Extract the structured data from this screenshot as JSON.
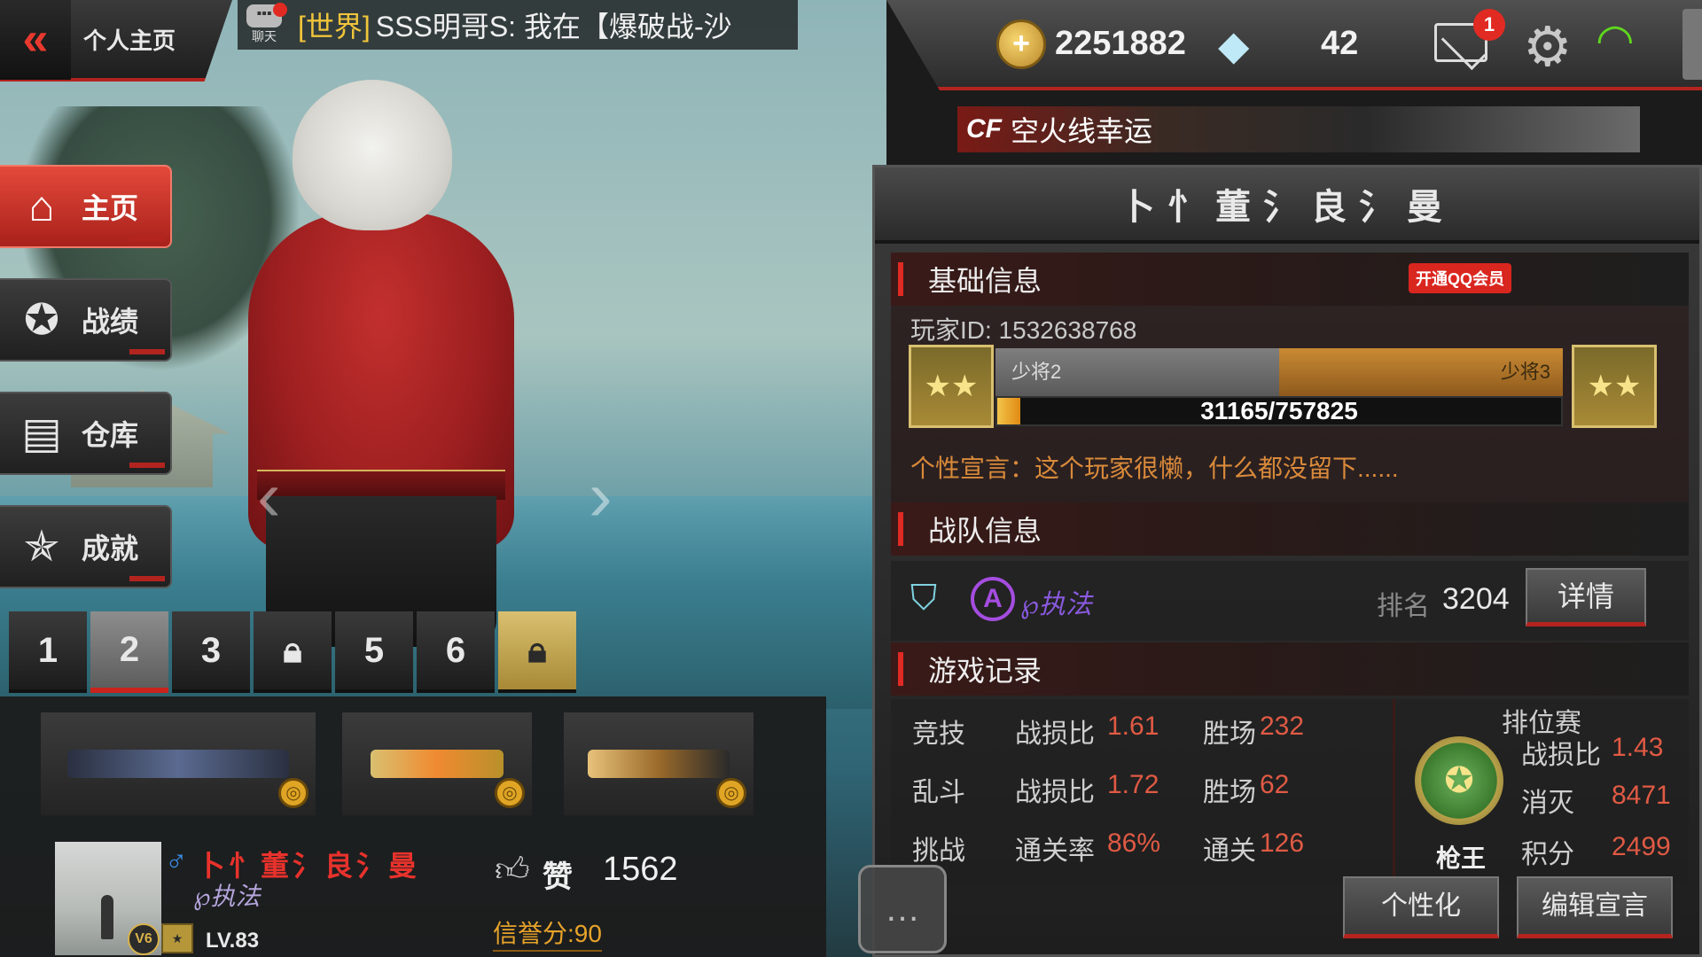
{
  "header": {
    "back_icon": "double-chevron-left-icon",
    "title": "个人主页"
  },
  "chat": {
    "icon_label": "聊天",
    "channel": "[世界]",
    "message": "SSS明哥S: 我在【爆破战-沙"
  },
  "side_nav": [
    {
      "label": "主页",
      "icon": "house-icon",
      "active": true
    },
    {
      "label": "战绩",
      "icon": "star-wings-icon",
      "active": false
    },
    {
      "label": "仓库",
      "icon": "crate-icon",
      "active": false
    },
    {
      "label": "成就",
      "icon": "trophy-star-icon",
      "active": false
    }
  ],
  "slots": [
    {
      "label": "1",
      "locked": false
    },
    {
      "label": "2",
      "locked": false,
      "active": true
    },
    {
      "label": "3",
      "locked": false
    },
    {
      "label": "",
      "locked": true
    },
    {
      "label": "5",
      "locked": false
    },
    {
      "label": "6",
      "locked": false
    },
    {
      "label": "",
      "locked": true,
      "gold": true
    }
  ],
  "weapons": [
    {
      "name": "primary-rifle",
      "icon": "rifle-icon"
    },
    {
      "name": "secondary-pistol",
      "icon": "pistol-icon"
    },
    {
      "name": "melee-weapon",
      "icon": "blade-icon"
    }
  ],
  "player": {
    "gender_symbol": "♂",
    "name": "卜忄董氵良氵曼",
    "tag": "℘执法",
    "vip": "V6",
    "level": "LV.83",
    "like_label": "赞",
    "likes": "1562",
    "credit": "信誉分:90"
  },
  "currency": {
    "gold": "2251882",
    "diamonds": "42",
    "mail_badge": "1"
  },
  "banner": {
    "logo": "CF",
    "text": "空火线幸运"
  },
  "panel": {
    "title": "卜忄董氵良氵曼",
    "basic_info_header": "基础信息",
    "qq_member_label": "开通QQ会员",
    "player_id": "玩家ID: 1532638768",
    "rank_current": "少将2",
    "rank_next": "少将3",
    "xp_text": "31165/757825",
    "xp_progress": 0.041,
    "motto": "个性宣言：这个玩家很懒，什么都没留下......",
    "team_header": "战队信息",
    "team_name": "℘执法",
    "team_rank_label": "排名",
    "team_rank": "3204",
    "team_detail_button": "详情",
    "records_header": "游戏记录",
    "records": [
      {
        "mode": "竞技",
        "k1": "战损比",
        "v1": "1.61",
        "k2": "胜场",
        "v2": "232"
      },
      {
        "mode": "乱斗",
        "k1": "战损比",
        "v1": "1.72",
        "k2": "胜场",
        "v2": "62"
      },
      {
        "mode": "挑战",
        "k1": "通关率",
        "v1": "86%",
        "k2": "通关",
        "v2": "126"
      }
    ],
    "ranked": {
      "title": "排位赛",
      "emblem_label": "枪王",
      "rows": [
        {
          "k": "战损比",
          "v": "1.43"
        },
        {
          "k": "消灭",
          "v": "8471"
        },
        {
          "k": "积分",
          "v": "2499"
        }
      ]
    },
    "button_personalize": "个性化",
    "button_edit_motto": "编辑宣言"
  },
  "colors": {
    "accent_red": "#e02a24",
    "stat_red": "#e05a44",
    "gold": "#e8a32a",
    "wifi_green": "#5fd61e"
  }
}
